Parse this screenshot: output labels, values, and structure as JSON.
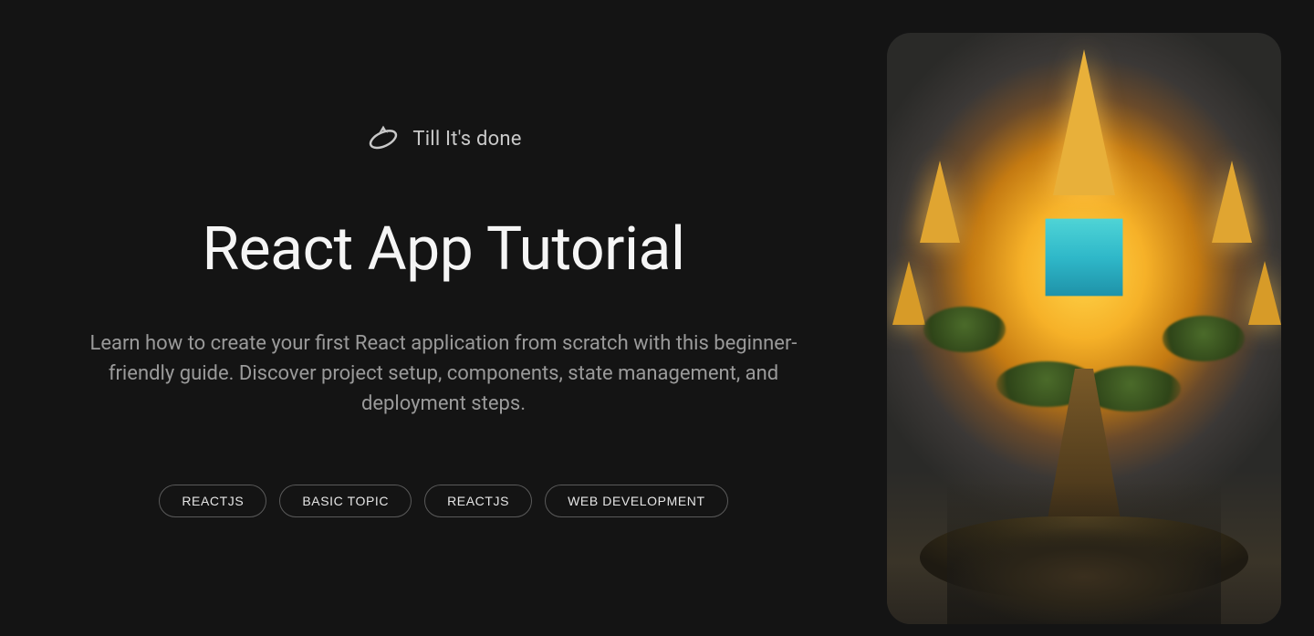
{
  "brand": {
    "name": "Till It's done"
  },
  "hero": {
    "title": "React App Tutorial",
    "subtitle": "Learn how to create your first React application from scratch with this beginner-friendly guide. Discover project setup, components, state management, and deployment steps."
  },
  "tags": [
    "REACTJS",
    "BASIC TOPIC",
    "REACTJS",
    "WEB DEVELOPMENT"
  ]
}
